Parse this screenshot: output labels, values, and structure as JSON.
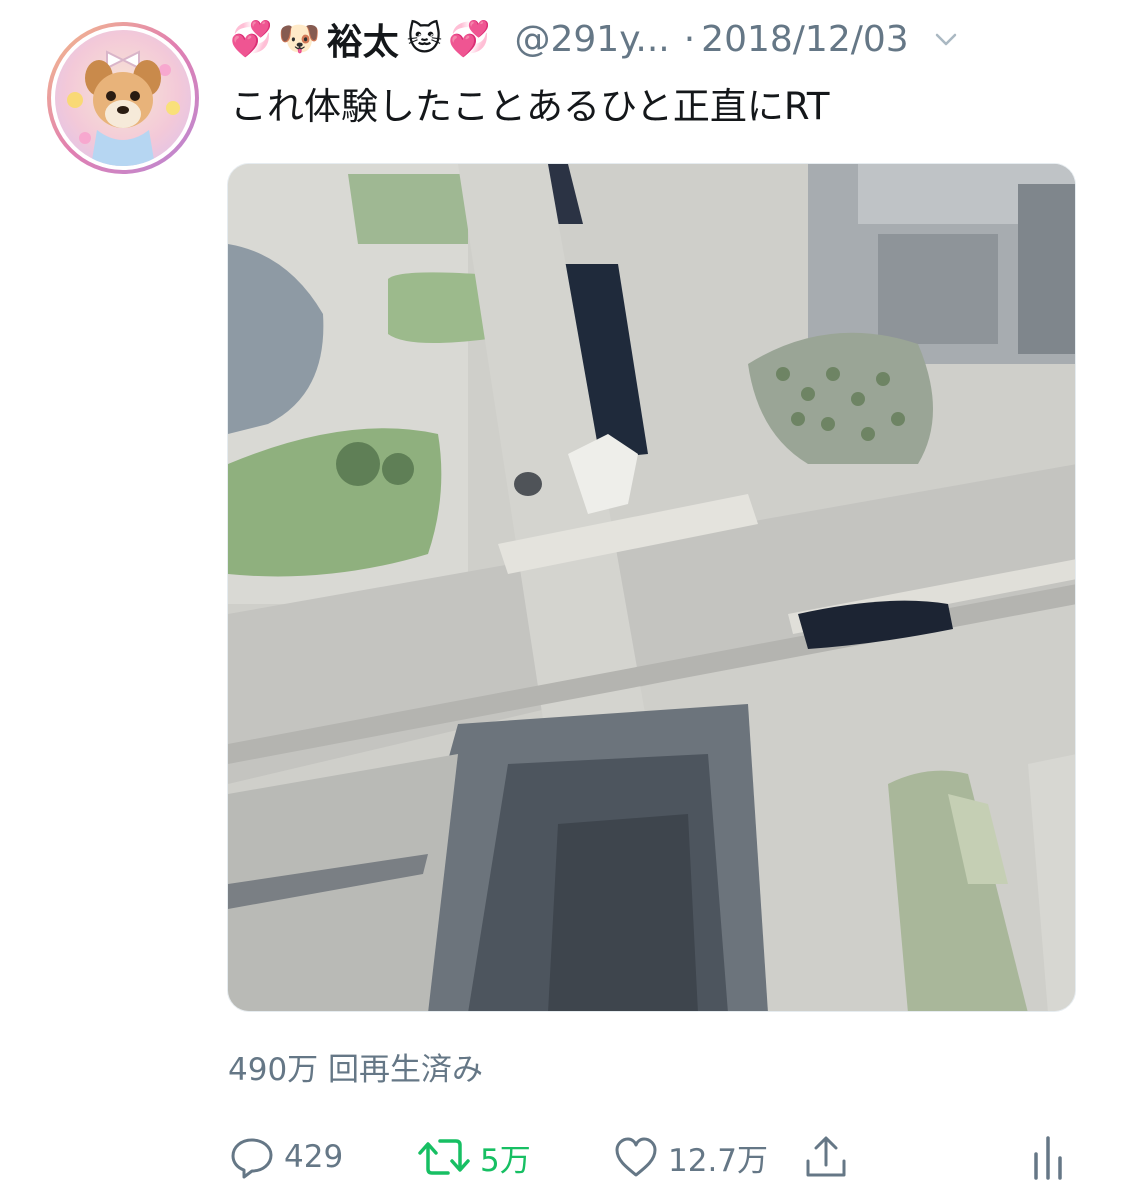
{
  "tweet": {
    "display_name": "裕太",
    "name_emojis": [
      "💞",
      "🐶",
      "🐱",
      "💞"
    ],
    "handle": "@291y...",
    "separator": "·",
    "date": "2018/12/03",
    "text": "これ体験したことあるひと正直にRT",
    "views": "490万 回再生済み"
  },
  "actions": {
    "reply_count": "429",
    "retweet_count": "5万",
    "like_count": "12.7万"
  },
  "icons": {
    "reply": "reply-bubble-icon",
    "retweet": "retweet-icon",
    "like": "heart-icon",
    "share": "share-icon",
    "analytics": "analytics-bars-icon",
    "more": "chevron-down-icon"
  },
  "colors": {
    "text": "#14171a",
    "secondary": "#657786",
    "retweet_active": "#17bf63"
  }
}
